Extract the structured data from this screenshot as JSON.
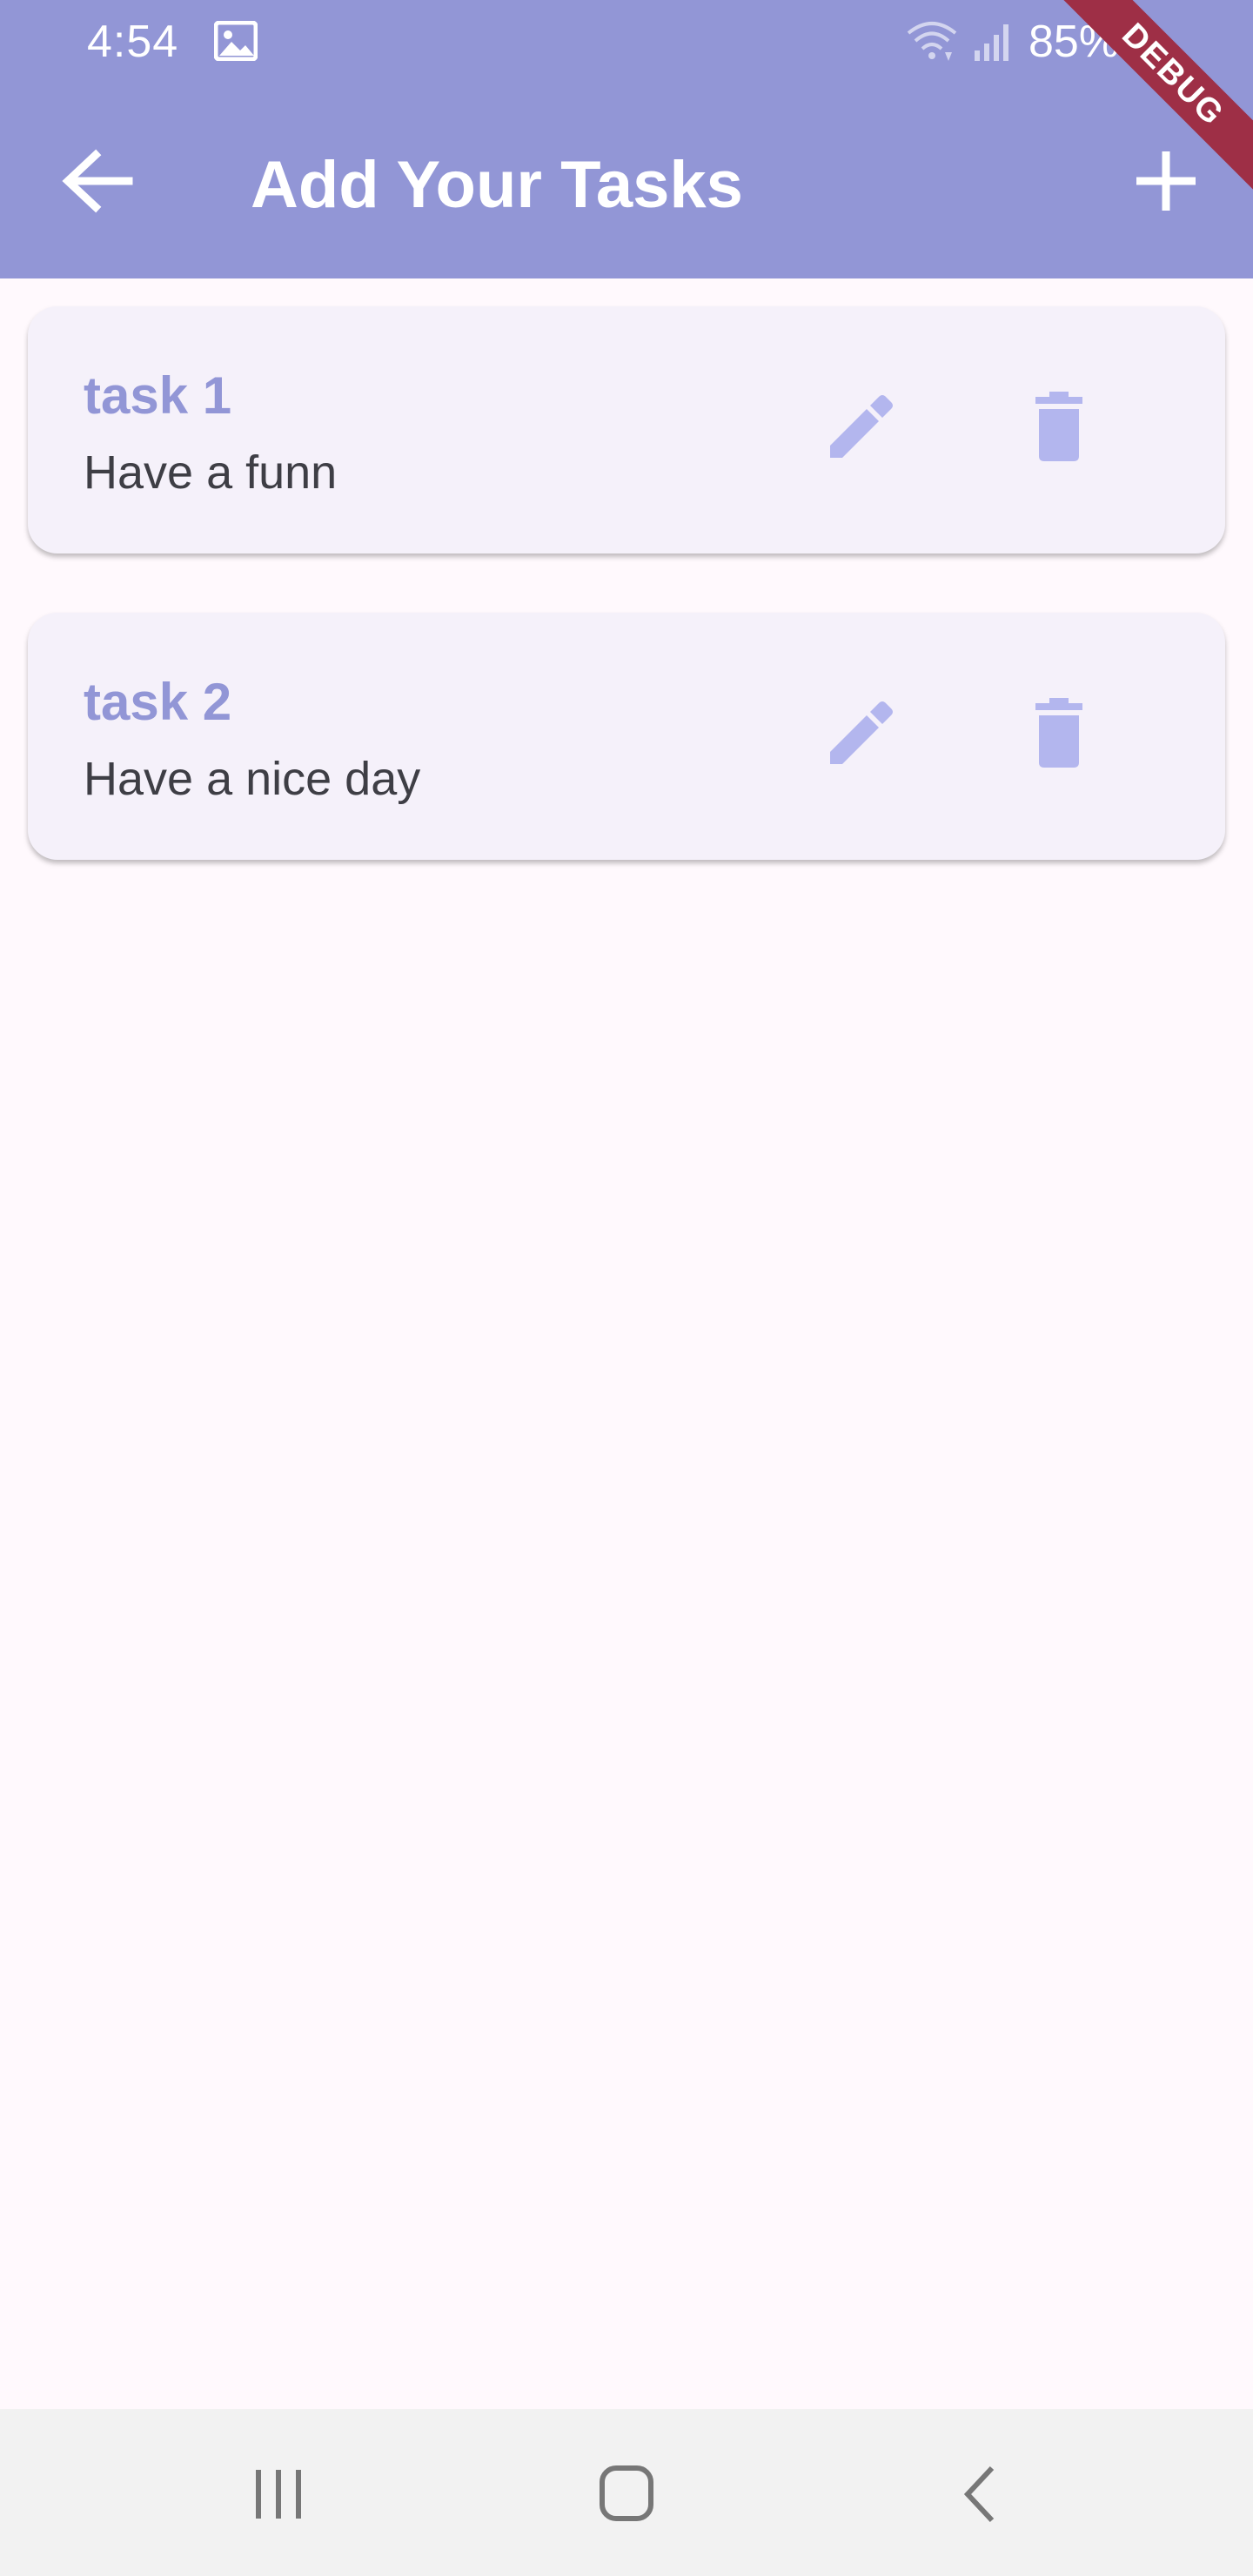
{
  "status_bar": {
    "time": "4:54",
    "battery": "85%",
    "icons": [
      "image-icon",
      "wifi-icon",
      "signal-icon",
      "battery-icon"
    ]
  },
  "debug_banner": {
    "label": "DEBUG",
    "color": "#9e2f46"
  },
  "app_bar": {
    "title": "Add Your Tasks",
    "back_icon": "arrow-back-icon",
    "add_icon": "plus-icon",
    "color": "#9296d6"
  },
  "tasks": [
    {
      "title": "task 1",
      "subtitle": "Have a funn",
      "edit_icon": "pencil-icon",
      "delete_icon": "trash-icon"
    },
    {
      "title": "task 2",
      "subtitle": "Have a nice day",
      "edit_icon": "pencil-icon",
      "delete_icon": "trash-icon"
    }
  ],
  "nav_bar": {
    "icons": [
      "recents-icon",
      "home-icon",
      "back-icon"
    ]
  },
  "colors": {
    "accent": "#9296d6",
    "icon_tint": "#b3b6ee",
    "card_bg": "#f5f1fa",
    "page_bg": "#fff9fd"
  }
}
